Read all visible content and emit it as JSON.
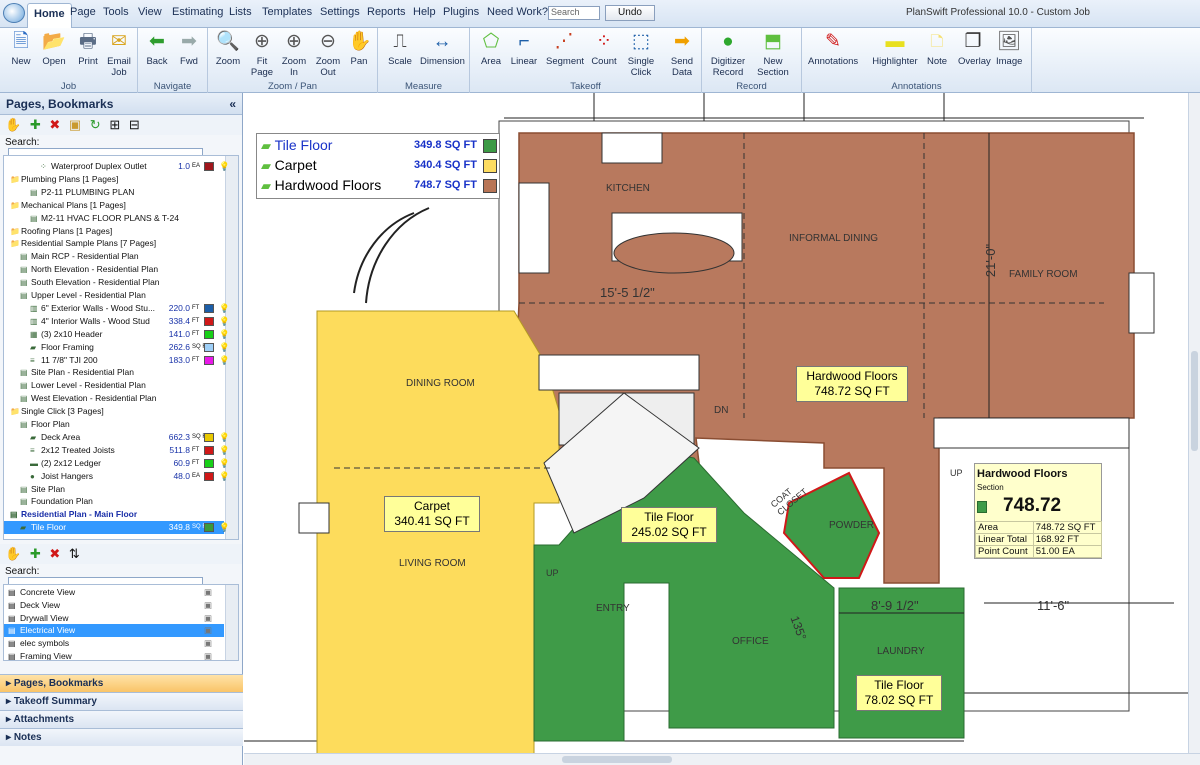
{
  "menu": {
    "items": [
      "Home",
      "Page",
      "Tools",
      "View",
      "Estimating",
      "Lists",
      "Templates",
      "Settings",
      "Reports",
      "Help",
      "Plugins",
      "Need Work?"
    ],
    "search_placeholder": "Search",
    "undo": "Undo",
    "window_title": "PlanSwift Professional 10.0 - Custom Job"
  },
  "ribbon": {
    "groups": [
      {
        "label": "Job"
      },
      {
        "label": "Navigate"
      },
      {
        "label": "Zoom / Pan"
      },
      {
        "label": "Measure"
      },
      {
        "label": "Takeoff"
      },
      {
        "label": "Record"
      },
      {
        "label": "Annotations"
      }
    ],
    "buttons": [
      {
        "label": "New",
        "icon": "new-document-icon",
        "glyph": "🗎"
      },
      {
        "label": "Open",
        "icon": "open-folder-icon",
        "glyph": "📂"
      },
      {
        "label": "Print",
        "icon": "printer-icon",
        "glyph": "🖶"
      },
      {
        "label": "Email\nJob",
        "icon": "email-icon",
        "glyph": "✉"
      },
      {
        "label": "Back",
        "icon": "back-arrow-icon",
        "glyph": "⬅"
      },
      {
        "label": "Fwd",
        "icon": "forward-arrow-icon",
        "glyph": "➡"
      },
      {
        "label": "Zoom",
        "icon": "zoom-icon",
        "glyph": "🔍"
      },
      {
        "label": "Fit\nPage",
        "icon": "fit-page-icon",
        "glyph": "⊕"
      },
      {
        "label": "Zoom\nIn",
        "icon": "zoom-in-icon",
        "glyph": "⊕"
      },
      {
        "label": "Zoom\nOut",
        "icon": "zoom-out-icon",
        "glyph": "⊖"
      },
      {
        "label": "Pan",
        "icon": "pan-hand-icon",
        "glyph": "✋"
      },
      {
        "label": "Scale",
        "icon": "scale-icon",
        "glyph": "⎍"
      },
      {
        "label": "Dimension",
        "icon": "dimension-icon",
        "glyph": "↔"
      },
      {
        "label": "Area",
        "icon": "area-icon",
        "glyph": "⬠"
      },
      {
        "label": "Linear",
        "icon": "linear-icon",
        "glyph": "⌐"
      },
      {
        "label": "Segment",
        "icon": "segment-icon",
        "glyph": "⋰"
      },
      {
        "label": "Count",
        "icon": "count-icon",
        "glyph": "⁘"
      },
      {
        "label": "Single\nClick",
        "icon": "single-click-icon",
        "glyph": "⬚"
      },
      {
        "label": "Send\nData",
        "icon": "send-data-icon",
        "glyph": "➡"
      },
      {
        "label": "Digitizer\nRecord",
        "icon": "digitizer-record-icon",
        "glyph": "●"
      },
      {
        "label": "New\nSection",
        "icon": "new-section-icon",
        "glyph": "⬒"
      },
      {
        "label": "Annotations",
        "icon": "annotations-icon",
        "glyph": "✎"
      },
      {
        "label": "Highlighter",
        "icon": "highlighter-icon",
        "glyph": "▬"
      },
      {
        "label": "Note",
        "icon": "note-icon",
        "glyph": "🗅"
      },
      {
        "label": "Overlay",
        "icon": "overlay-icon",
        "glyph": "❐"
      },
      {
        "label": "Image",
        "icon": "image-icon",
        "glyph": "🖼"
      }
    ]
  },
  "left": {
    "pages_title": "Pages, Bookmarks",
    "search_label": "Search:",
    "tree": [
      {
        "label": "Waterproof Duplex Outlet",
        "value": "1.0",
        "unit": "EA",
        "color": "#a0161c",
        "indent": 3,
        "icon": "outlet-icon"
      },
      {
        "label": "Plumbing Plans [1 Pages]",
        "indent": 0,
        "icon": "folder-icon"
      },
      {
        "label": "P2-11 PLUMBING PLAN",
        "indent": 2,
        "icon": "page-icon"
      },
      {
        "label": "Mechanical Plans [1 Pages]",
        "indent": 0,
        "icon": "folder-icon"
      },
      {
        "label": "M2-11 HVAC FLOOR PLANS & T-24",
        "indent": 2,
        "icon": "page-icon"
      },
      {
        "label": "Roofing Plans [1 Pages]",
        "indent": 0,
        "icon": "folder-icon"
      },
      {
        "label": "Residential Sample Plans [7 Pages]",
        "indent": 0,
        "icon": "folder-icon"
      },
      {
        "label": "Main RCP - Residential Plan",
        "indent": 1,
        "icon": "page-icon"
      },
      {
        "label": "North Elevation - Residential Plan",
        "indent": 1,
        "icon": "page-icon"
      },
      {
        "label": "South Elevation - Residential Plan",
        "indent": 1,
        "icon": "page-icon"
      },
      {
        "label": "Upper Level - Residential Plan",
        "indent": 1,
        "icon": "page-icon"
      },
      {
        "label": "6\" Exterior Walls - Wood Stu...",
        "value": "220.0",
        "unit": "FT",
        "color": "#1c5ea8",
        "indent": 2,
        "icon": "wall-icon"
      },
      {
        "label": "4\" Interior Walls - Wood Stud",
        "value": "338.4",
        "unit": "FT",
        "color": "#d01818",
        "indent": 2,
        "icon": "wall-icon"
      },
      {
        "label": "(3) 2x10 Header",
        "value": "141.0",
        "unit": "FT",
        "color": "#18d018",
        "indent": 2,
        "icon": "header-icon"
      },
      {
        "label": "Floor Framing",
        "value": "262.6",
        "unit": "SQ FT",
        "color": "#9ecff7",
        "indent": 2,
        "icon": "area-icon"
      },
      {
        "label": "11 7/8\" TJI 200",
        "value": "183.0",
        "unit": "FT",
        "color": "#e818e8",
        "indent": 2,
        "icon": "joist-icon"
      },
      {
        "label": "Site Plan - Residential Plan",
        "indent": 1,
        "icon": "page-icon"
      },
      {
        "label": "Lower Level - Residential Plan",
        "indent": 1,
        "icon": "page-icon"
      },
      {
        "label": "West Elevation - Residential Plan",
        "indent": 1,
        "icon": "page-icon"
      },
      {
        "label": "Single Click [3 Pages]",
        "indent": 0,
        "icon": "folder-icon"
      },
      {
        "label": "Floor Plan",
        "indent": 1,
        "icon": "page-icon"
      },
      {
        "label": "Deck Area",
        "value": "662.3",
        "unit": "SQ FT",
        "color": "#e8c800",
        "indent": 2,
        "icon": "area-icon"
      },
      {
        "label": "2x12 Treated Joists",
        "value": "511.8",
        "unit": "FT",
        "color": "#d01818",
        "indent": 2,
        "icon": "joist-icon"
      },
      {
        "label": "(2) 2x12 Ledger",
        "value": "60.9",
        "unit": "FT",
        "color": "#18d018",
        "indent": 2,
        "icon": "ledger-icon"
      },
      {
        "label": "Joist Hangers",
        "value": "48.0",
        "unit": "EA",
        "color": "#d01818",
        "indent": 2,
        "icon": "count-icon"
      },
      {
        "label": "Site Plan",
        "indent": 1,
        "icon": "page-icon"
      },
      {
        "label": "Foundation Plan",
        "indent": 1,
        "icon": "page-icon"
      },
      {
        "label": "Residential Plan - Main Floor",
        "indent": 0,
        "icon": "page-icon",
        "bold": true
      },
      {
        "label": "Tile Floor",
        "value": "349.8",
        "unit": "SQ FT",
        "color": "#3a9a3a",
        "indent": 1,
        "icon": "area-icon",
        "selected": true
      }
    ],
    "views_search_label": "Search:",
    "views": [
      "Concrete View",
      "Deck View",
      "Drywall View",
      "Electrical View",
      "elec symbols",
      "Framing View"
    ],
    "selected_view": "Electrical View",
    "panel_buttons": [
      "Pages, Bookmarks",
      "Takeoff Summary",
      "Attachments",
      "Notes"
    ]
  },
  "canvas": {
    "legend": [
      {
        "name": "Tile Floor",
        "value": "349.8 SQ FT",
        "color": "#3c9a45",
        "text_color": "#1832c8"
      },
      {
        "name": "Carpet",
        "value": "340.4 SQ FT",
        "color": "#fddc60",
        "text_color": "#000"
      },
      {
        "name": "Hardwood Floors",
        "value": "748.7 SQ FT",
        "color": "#b87556",
        "text_color": "#000"
      }
    ],
    "rooms": [
      "KITCHEN",
      "INFORMAL DINING",
      "FAMILY ROOM",
      "DINING ROOM",
      "LIVING ROOM",
      "ENTRY",
      "OFFICE",
      "POWDER",
      "LAUNDRY",
      "COAT\nCLOSET",
      "DN",
      "UP",
      "UP"
    ],
    "dims": [
      "15'-5 1/2\"",
      "21'-0\"",
      "8'-9 1/2\"",
      "11'-6\"",
      "135°"
    ],
    "labels": [
      {
        "text": "Hardwood Floors\n748.72 SQ FT"
      },
      {
        "text": "Carpet\n340.41 SQ FT"
      },
      {
        "text": "Tile Floor\n245.02 SQ FT"
      },
      {
        "text": "Tile Floor\n78.02 SQ FT"
      }
    ],
    "info": {
      "title": "Hardwood Floors",
      "subtitle": "Section",
      "big": "748.72",
      "rows": [
        [
          "Area",
          "748.72 SQ FT"
        ],
        [
          "Linear Total",
          "168.92 FT"
        ],
        [
          "Point Count",
          "51.00 EA"
        ]
      ]
    }
  },
  "colors": {
    "tile": "#3f9b48",
    "carpet": "#fddc5c",
    "hardwood": "#b8795e",
    "accent": "#3399ff"
  }
}
